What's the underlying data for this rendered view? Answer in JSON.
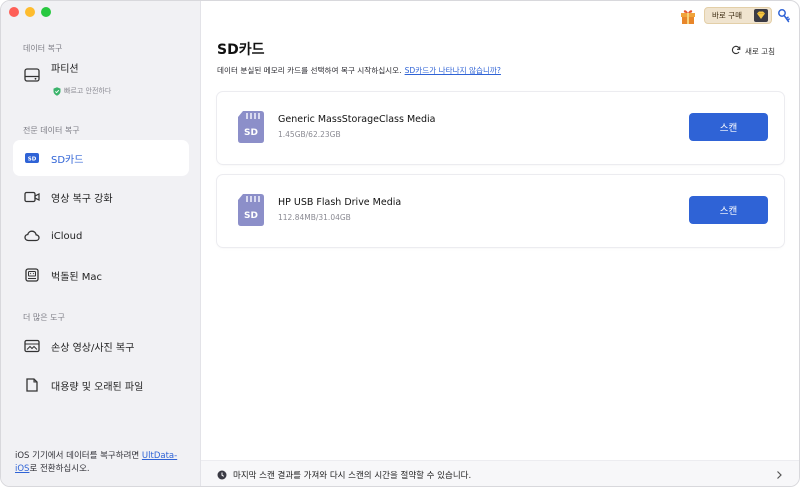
{
  "sidebar": {
    "section_recovery": "데이터 복구",
    "partition": {
      "label": "파티션",
      "sub": "빠르고 안전하다"
    },
    "section_pro": "전문 데이터 복구",
    "sd_card": "SD카드",
    "video_repair": "영상 복구 강화",
    "icloud": "iCloud",
    "crashed_mac": "벅돌된 Mac",
    "section_more": "더 많은 도구",
    "damaged": "손상 영상/사진 복구",
    "large_files": "대용량 및 오래된 파일",
    "footer_prefix": "iOS 기기에서 데이터를 복구하려면 ",
    "footer_link_1": "UltData-",
    "footer_link_2": "iOS",
    "footer_suffix": "로 전환하십시오."
  },
  "topbar": {
    "buy_label": "바로 구매"
  },
  "main": {
    "title": "SD카드",
    "desc": "데이터 분실된 메모리 카드를 선택하여 복구 시작하십시오.",
    "desc_link": "SD카드가 나타나지 않습니까?",
    "refresh": "새로 고침"
  },
  "devices": [
    {
      "name": "Generic MassStorageClass Media",
      "size": "1.45GB/62.23GB",
      "button": "스캔"
    },
    {
      "name": "HP USB Flash Drive Media",
      "size": "112.84MB/31.04GB",
      "button": "스캔"
    }
  ],
  "bottom": {
    "text": "마지막 스캔 결과를 가져와 다시 스캔의 시간을 절약할 수 있습니다."
  },
  "colors": {
    "accent": "#2f63d6",
    "sidebar_bg": "#f1f1f4"
  }
}
